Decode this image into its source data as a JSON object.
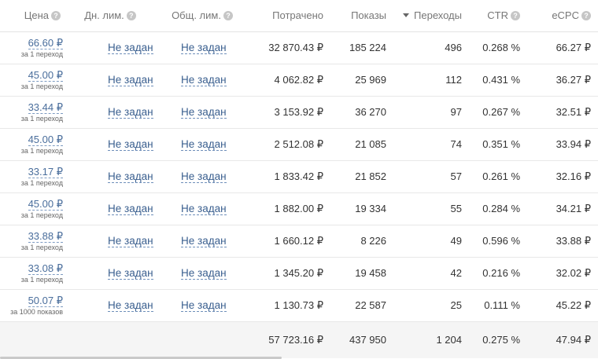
{
  "columns": {
    "price": "Цена",
    "day_limit": "Дн. лим.",
    "total_limit": "Общ. лим.",
    "spent": "Потрачено",
    "impressions": "Показы",
    "clicks": "Переходы",
    "ctr": "CTR",
    "ecpc": "eCPC",
    "help_glyph": "?"
  },
  "rows": [
    {
      "price": "66.60 ₽",
      "price_unit": "за 1 переход",
      "day_limit": "Не задан",
      "total_limit": "Не задан",
      "spent": "32 870.43 ₽",
      "impressions": "185 224",
      "clicks": "496",
      "ctr": "0.268 %",
      "ecpc": "66.27 ₽"
    },
    {
      "price": "45.00 ₽",
      "price_unit": "за 1 переход",
      "day_limit": "Не задан",
      "total_limit": "Не задан",
      "spent": "4 062.82 ₽",
      "impressions": "25 969",
      "clicks": "112",
      "ctr": "0.431 %",
      "ecpc": "36.27 ₽"
    },
    {
      "price": "33.44 ₽",
      "price_unit": "за 1 переход",
      "day_limit": "Не задан",
      "total_limit": "Не задан",
      "spent": "3 153.92 ₽",
      "impressions": "36 270",
      "clicks": "97",
      "ctr": "0.267 %",
      "ecpc": "32.51 ₽"
    },
    {
      "price": "45.00 ₽",
      "price_unit": "за 1 переход",
      "day_limit": "Не задан",
      "total_limit": "Не задан",
      "spent": "2 512.08 ₽",
      "impressions": "21 085",
      "clicks": "74",
      "ctr": "0.351 %",
      "ecpc": "33.94 ₽"
    },
    {
      "price": "33.17 ₽",
      "price_unit": "за 1 переход",
      "day_limit": "Не задан",
      "total_limit": "Не задан",
      "spent": "1 833.42 ₽",
      "impressions": "21 852",
      "clicks": "57",
      "ctr": "0.261 %",
      "ecpc": "32.16 ₽"
    },
    {
      "price": "45.00 ₽",
      "price_unit": "за 1 переход",
      "day_limit": "Не задан",
      "total_limit": "Не задан",
      "spent": "1 882.00 ₽",
      "impressions": "19 334",
      "clicks": "55",
      "ctr": "0.284 %",
      "ecpc": "34.21 ₽"
    },
    {
      "price": "33.88 ₽",
      "price_unit": "за 1 переход",
      "day_limit": "Не задан",
      "total_limit": "Не задан",
      "spent": "1 660.12 ₽",
      "impressions": "8 226",
      "clicks": "49",
      "ctr": "0.596 %",
      "ecpc": "33.88 ₽"
    },
    {
      "price": "33.08 ₽",
      "price_unit": "за 1 переход",
      "day_limit": "Не задан",
      "total_limit": "Не задан",
      "spent": "1 345.20 ₽",
      "impressions": "19 458",
      "clicks": "42",
      "ctr": "0.216 %",
      "ecpc": "32.02 ₽"
    },
    {
      "price": "50.07 ₽",
      "price_unit": "за 1000 показов",
      "day_limit": "Не задан",
      "total_limit": "Не задан",
      "spent": "1 130.73 ₽",
      "impressions": "22 587",
      "clicks": "25",
      "ctr": "0.111 %",
      "ecpc": "45.22 ₽"
    }
  ],
  "totals": {
    "spent": "57 723.16 ₽",
    "impressions": "437 950",
    "clicks": "1 204",
    "ctr": "0.275 %",
    "ecpc": "47.94 ₽"
  },
  "colors": {
    "link": "#3a5f8f",
    "header_text": "#777777",
    "footer_bg": "#f5f5f5"
  }
}
